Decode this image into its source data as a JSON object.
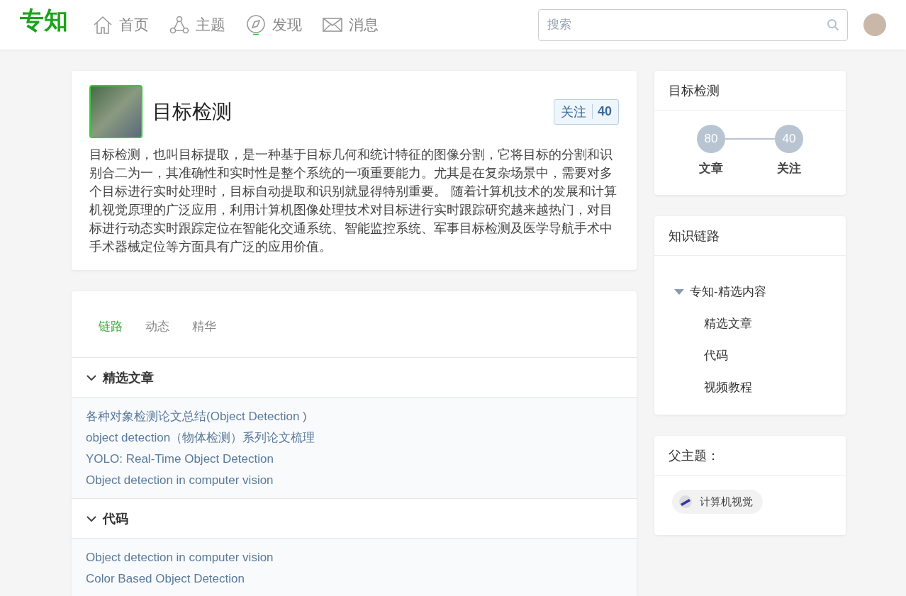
{
  "header": {
    "logo": "专知",
    "nav": [
      {
        "label": "首页"
      },
      {
        "label": "主题"
      },
      {
        "label": "发现"
      },
      {
        "label": "消息"
      }
    ],
    "search": {
      "placeholder": "搜索"
    }
  },
  "topic": {
    "title": "目标检测",
    "follow": {
      "label": "关注",
      "count": "40"
    },
    "description": "目标检测，也叫目标提取，是一种基于目标几何和统计特征的图像分割，它将目标的分割和识别合二为一，其准确性和实时性是整个系统的一项重要能力。尤其是在复杂场景中，需要对多个目标进行实时处理时，目标自动提取和识别就显得特别重要。 随着计算机技术的发展和计算机视觉原理的广泛应用，利用计算机图像处理技术对目标进行实时跟踪研究越来越热门，对目标进行动态实时跟踪定位在智能化交通系统、智能监控系统、军事目标检测及医学导航手术中手术器械定位等方面具有广泛的应用价值。"
  },
  "tabs": [
    {
      "label": "链路",
      "selected": true
    },
    {
      "label": "动态",
      "selected": false
    },
    {
      "label": "精华",
      "selected": false
    }
  ],
  "sections": [
    {
      "title": "精选文章",
      "expanded": true,
      "links": [
        "各种对象检测论文总结(Object Detection )",
        "object detection（物体检测）系列论文梳理",
        "YOLO: Real-Time Object Detection",
        "Object detection in computer vision"
      ]
    },
    {
      "title": "代码",
      "expanded": true,
      "links": [
        "Object detection in computer vision",
        "Color Based Object Detection"
      ]
    }
  ],
  "sidebar": {
    "stats": {
      "title": "目标检测",
      "items": [
        {
          "value": "80",
          "label": "文章"
        },
        {
          "value": "40",
          "label": "关注"
        }
      ]
    },
    "knowledge": {
      "title": "知识链路",
      "tree": [
        {
          "label": "专知-精选内容",
          "expanded": true,
          "children": [
            {
              "label": "精选文章"
            },
            {
              "label": "代码"
            },
            {
              "label": "视频教程"
            }
          ]
        }
      ]
    },
    "parent": {
      "title": "父主题：",
      "tags": [
        "计算机视觉"
      ]
    }
  }
}
